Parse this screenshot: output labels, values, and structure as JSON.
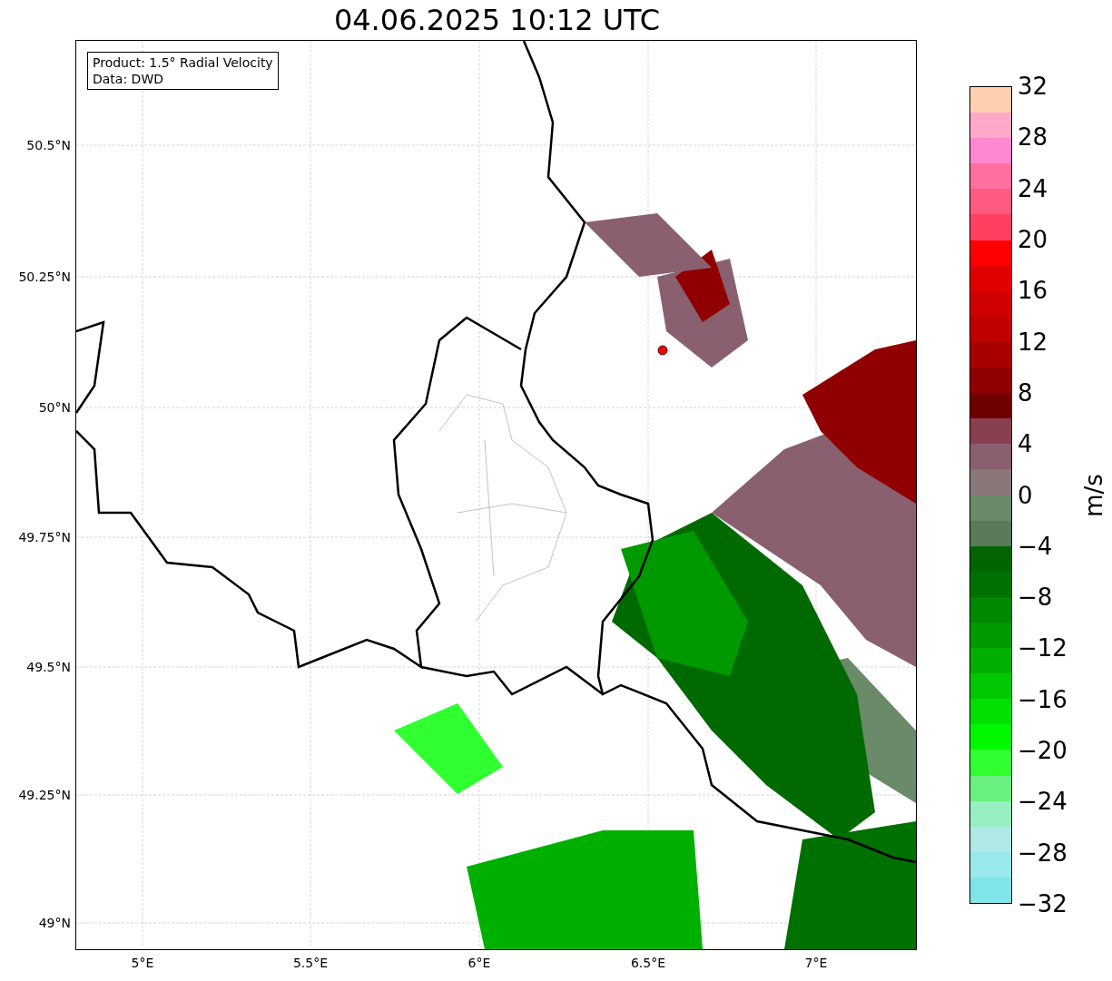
{
  "title": "04.06.2025 10:12 UTC",
  "legend": [
    "Product: 1.5° Radial Velocity",
    "Data: DWD"
  ],
  "lat_ticks": [
    "50.5°N",
    "50.25°N",
    "50°N",
    "49.75°N",
    "49.5°N",
    "49.25°N",
    "49°N"
  ],
  "lon_ticks": [
    "5°E",
    "5.5°E",
    "6°E",
    "6.5°E",
    "7°E"
  ],
  "colorbar": {
    "label": "m/s",
    "ticks": [
      "32",
      "28",
      "24",
      "20",
      "16",
      "12",
      "8",
      "4",
      "0",
      "−4",
      "−8",
      "−12",
      "−16",
      "−20",
      "−24",
      "−28",
      "−32"
    ],
    "bins": [
      {
        "color": "#ffd0b0"
      },
      {
        "color": "#ffa8c8"
      },
      {
        "color": "#ff88d0"
      },
      {
        "color": "#ff70a0"
      },
      {
        "color": "#ff5a80"
      },
      {
        "color": "#ff4060"
      },
      {
        "color": "#ff0000"
      },
      {
        "color": "#e00000"
      },
      {
        "color": "#d00000"
      },
      {
        "color": "#c00000"
      },
      {
        "color": "#a80000"
      },
      {
        "color": "#900000"
      },
      {
        "color": "#700000"
      },
      {
        "color": "#884050"
      },
      {
        "color": "#8a6070"
      },
      {
        "color": "#8a7878"
      },
      {
        "color": "#6a8a6a"
      },
      {
        "color": "#5a7a5a"
      },
      {
        "color": "#006400"
      },
      {
        "color": "#007000"
      },
      {
        "color": "#008800"
      },
      {
        "color": "#009a00"
      },
      {
        "color": "#00b000"
      },
      {
        "color": "#00c800"
      },
      {
        "color": "#00e000"
      },
      {
        "color": "#00f800"
      },
      {
        "color": "#30ff30"
      },
      {
        "color": "#68f080"
      },
      {
        "color": "#98f0c0"
      },
      {
        "color": "#b0e8e8"
      },
      {
        "color": "#98e8ec"
      },
      {
        "color": "#80e4ea"
      }
    ]
  }
}
